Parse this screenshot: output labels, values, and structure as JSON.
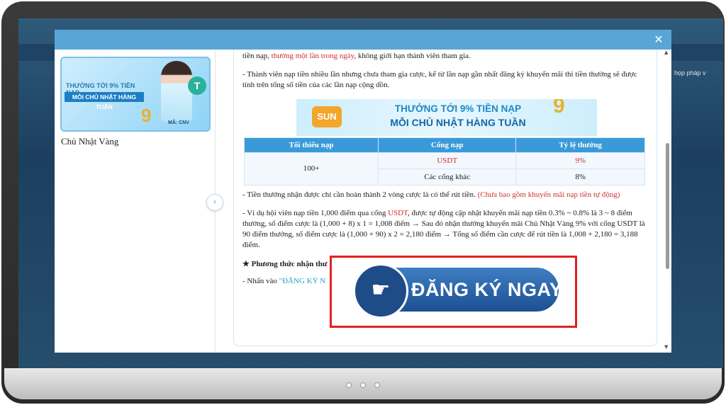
{
  "background": {
    "side_text": "họp pháp v"
  },
  "modal": {
    "close_icon": "✕",
    "left": {
      "thumb_line1": "THƯỞNG TỚI 9% TIỀN NẠP",
      "thumb_line2": "MỖI CHỦ NHẬT HÀNG TUẦN",
      "thumb_nine": "9",
      "thumb_coin": "T",
      "thumb_code": "MÃ: CNV",
      "label": "Chủ Nhật Vàng"
    },
    "collapse_icon": "‹",
    "content": {
      "p1_a": "tiền nạp, ",
      "p1_red": "thưởng một lần trong ngày",
      "p1_b": ", không giới hạn thành viên tham gia.",
      "p2": "- Thành viên nạp tiền nhiều lần nhưng chưa tham gia cược, kể từ lần nạp gần nhất đăng ký khuyến mãi thì tiền thưởng sẽ được tính trên tổng số tiền của các lần nạp cộng dồn.",
      "banner": {
        "line1": "THƯỞNG TỚI 9% TIỀN NẠP",
        "line2": "MỖI CHỦ NHẬT HÀNG TUẦN",
        "sun": "SUN",
        "nine": "9"
      },
      "table": {
        "headers": [
          "Tối thiểu nạp",
          "Cổng nạp",
          "Tỷ lệ thưởng"
        ],
        "min_deposit": "100+",
        "rows": [
          {
            "gate": "USDT",
            "rate": "9%"
          },
          {
            "gate": "Các cổng khác",
            "rate": "8%"
          }
        ]
      },
      "p3_a": "- Tiền thưởng nhận được chỉ cần hoàn thành 2 vòng cược là có thể rút tiền. ",
      "p3_red": "(Chưa bao gồm khuyến mãi nạp tiền tự động)",
      "p4_a": "- Ví dụ hội viên nạp tiền 1,000 điểm qua cổng ",
      "p4_red": "USDT",
      "p4_b": ", được tự động cập nhật khuyến mãi nạp tiền 0.3% ~ 0.8% là 3 ~ 8 điểm thưởng, số điểm cược là (1,000 + 8) x 1 = 1,008 điểm → Sau đó nhận thưởng khuyến mãi Chủ Nhật Vàng 9% với cổng USDT là 90 điểm thưởng, số điểm cược là (1,000 + 90) x 2 = 2,180 điểm → Tổng số điểm cần cược để rút tiền là 1,008 + 2,180 = 3,188 điểm.",
      "p5": "★ Phương thức nhận thư",
      "p6_a": "- Nhấn vào ",
      "p6_link": "\"ĐĂNG KÝ N"
    },
    "cta": {
      "icon": "☛",
      "label": "ĐĂNG KÝ NGAY"
    },
    "scroll": {
      "up": "▲",
      "down": "▼"
    }
  }
}
